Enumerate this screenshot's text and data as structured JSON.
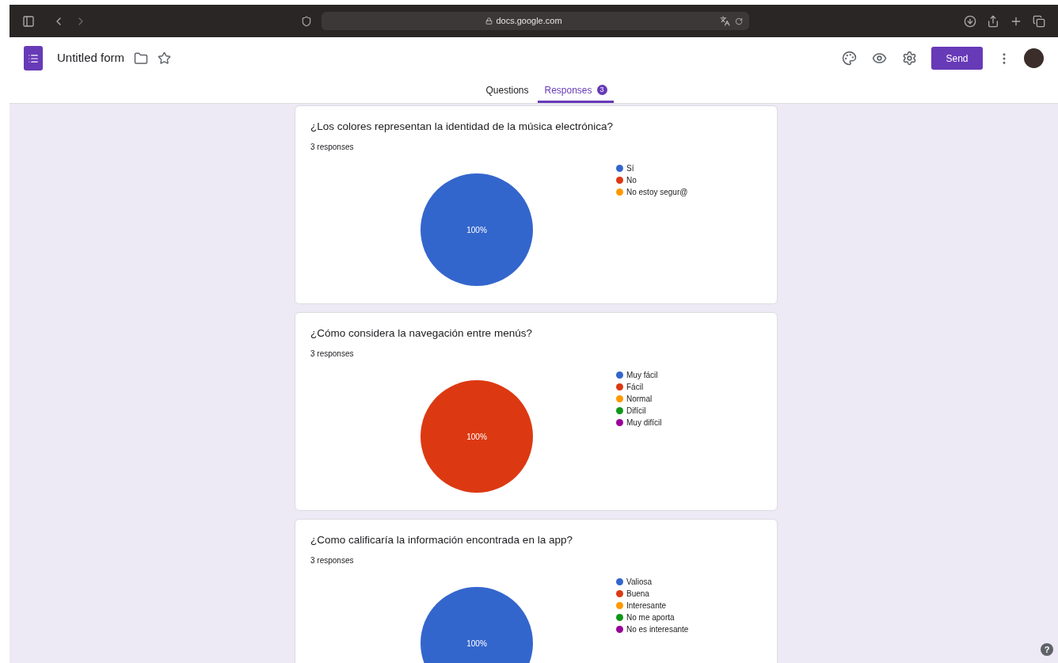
{
  "browser": {
    "url": "docs.google.com"
  },
  "header": {
    "title": "Untitled form",
    "send_label": "Send"
  },
  "tabs": [
    {
      "label": "Questions",
      "selected": false
    },
    {
      "label": "Responses",
      "selected": true,
      "count": "3"
    }
  ],
  "questions": [
    {
      "title": "¿Los colores representan la identidad de la música electrónica?",
      "responses": "3 responses",
      "chart_data": {
        "type": "pie",
        "categories": [
          "Sí",
          "No",
          "No estoy segur@"
        ],
        "values": [
          100,
          0,
          0
        ],
        "colors": [
          "#3366cc",
          "#dc3912",
          "#ff9900"
        ],
        "value_labels": [
          "100%",
          null,
          null
        ]
      }
    },
    {
      "title": "¿Cómo considera la navegación entre menús?",
      "responses": "3 responses",
      "chart_data": {
        "type": "pie",
        "categories": [
          "Muy fácil",
          "Fácil",
          "Normal",
          "Difícil",
          "Muy difícil"
        ],
        "values": [
          0,
          100,
          0,
          0,
          0
        ],
        "colors": [
          "#3366cc",
          "#dc3912",
          "#ff9900",
          "#109618",
          "#990099"
        ],
        "value_labels": [
          null,
          "100%",
          null,
          null,
          null
        ]
      }
    },
    {
      "title": "¿Como calificaría la información encontrada en la app?",
      "responses": "3 responses",
      "chart_data": {
        "type": "pie",
        "categories": [
          "Valiosa",
          "Buena",
          "Interesante",
          "No me aporta",
          "No es interesante"
        ],
        "values": [
          100,
          0,
          0,
          0,
          0
        ],
        "colors": [
          "#3366cc",
          "#dc3912",
          "#ff9900",
          "#109618",
          "#990099"
        ],
        "value_labels": [
          "100%",
          null,
          null,
          null,
          null
        ]
      }
    }
  ],
  "help": "?"
}
